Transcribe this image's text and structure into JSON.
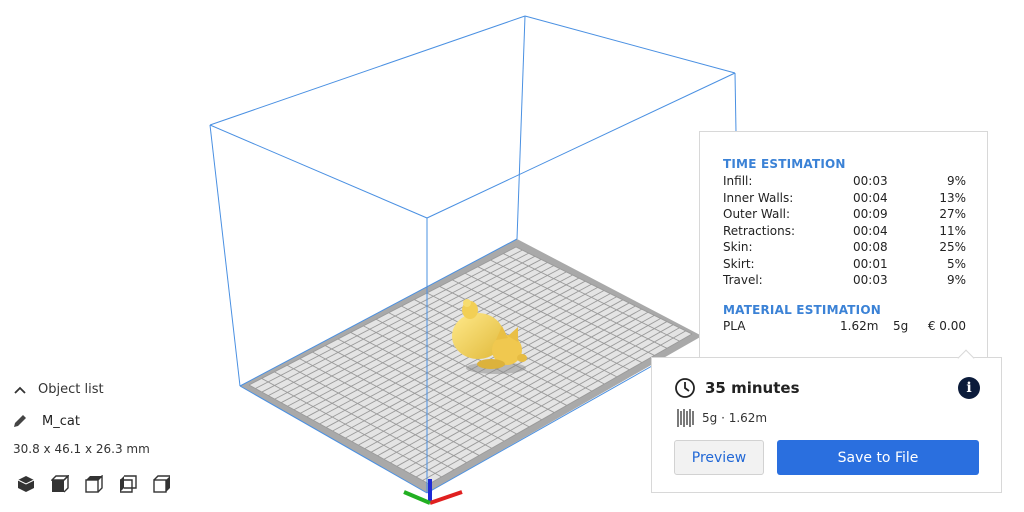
{
  "object_panel": {
    "list_label": "Object list",
    "object_name": "M_cat",
    "dimensions": "30.8 x 46.1 x 26.3 mm",
    "view_icons": [
      "view-3d-icon",
      "view-front-icon",
      "view-top-icon",
      "view-left-icon",
      "view-right-icon"
    ]
  },
  "time_estimation": {
    "title": "TIME ESTIMATION",
    "rows": [
      {
        "label": "Infill:",
        "time": "00:03",
        "percent": "9%"
      },
      {
        "label": "Inner Walls:",
        "time": "00:04",
        "percent": "13%"
      },
      {
        "label": "Outer Wall:",
        "time": "00:09",
        "percent": "27%"
      },
      {
        "label": "Retractions:",
        "time": "00:04",
        "percent": "11%"
      },
      {
        "label": "Skin:",
        "time": "00:08",
        "percent": "25%"
      },
      {
        "label": "Skirt:",
        "time": "00:01",
        "percent": "5%"
      },
      {
        "label": "Travel:",
        "time": "00:03",
        "percent": "9%"
      }
    ]
  },
  "material_estimation": {
    "title": "MATERIAL ESTIMATION",
    "material": "PLA",
    "length": "1.62m",
    "weight": "5g",
    "cost": "€ 0.00"
  },
  "action_panel": {
    "print_time": "35 minutes",
    "material_summary": "5g · 1.62m",
    "info_glyph": "i",
    "preview_label": "Preview",
    "save_label": "Save to File"
  },
  "colors": {
    "accent": "#2a6fdf",
    "heading": "#3b82d6",
    "build_volume": "#4a90e2",
    "model": "#f5d565",
    "info_button": "#0b1b3a"
  }
}
